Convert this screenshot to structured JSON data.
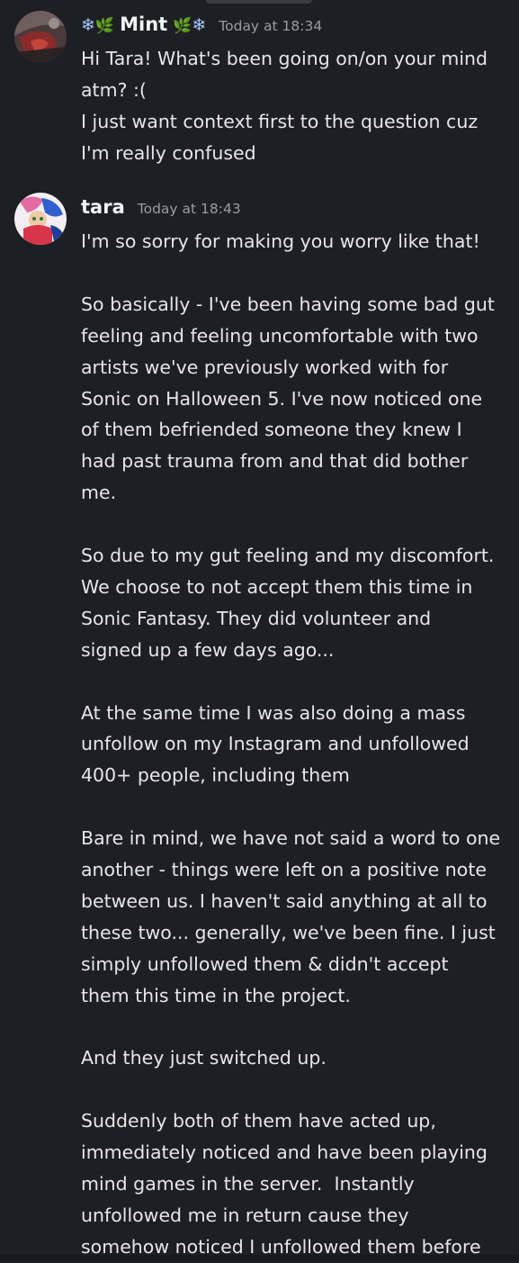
{
  "messages": [
    {
      "username": "Mint",
      "timestamp": "Today at 18:34",
      "paragraphs": [
        "Hi Tara! What's been going on/on your mind\natm? :(",
        "I just want context first to the question cuz\nI'm really confused"
      ]
    },
    {
      "username": "tara",
      "timestamp": "Today at 18:43",
      "paragraphs": [
        "I'm so sorry for making you worry like that!",
        "So basically - I've been having some bad gut\nfeeling and feeling uncomfortable with two\nartists we've previously worked with for\nSonic on Halloween 5. I've now noticed one\nof them befriended someone they knew I\nhad past trauma from and that did bother\nme.",
        "So due to my gut feeling and my discomfort.\nWe choose to not accept them this time in\nSonic Fantasy. They did volunteer and\nsigned up a few days ago...",
        "At the same time I was also doing a mass\nunfollow on my Instagram and unfollowed\n400+ people, including them",
        "Bare in mind, we have not said a word to one\nanother - things were left on a positive note\nbetween us. I haven't said anything at all to\nthese two... generally, we've been fine. I just\nsimply unfollowed them & didn't accept\nthem this time in the project.",
        "And they just switched up.",
        "Suddenly both of them have acted up,\nimmediately noticed and have been playing\nmind games in the server.  Instantly\nunfollowed me in return cause they\nsomehow noticed I unfollowed them before"
      ]
    }
  ]
}
